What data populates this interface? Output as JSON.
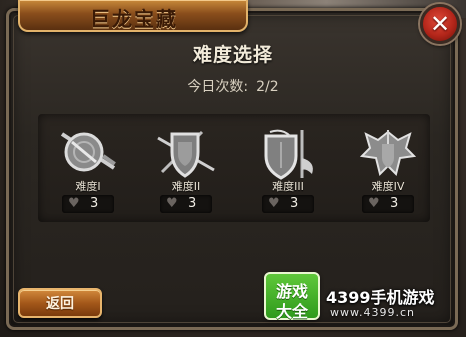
{
  "dialog": {
    "title": "巨龙宝藏",
    "heading": "难度选择",
    "count_label": "今日次数:",
    "count_value": "2/2",
    "close_icon": "✕"
  },
  "difficulties": [
    {
      "label": "难度I",
      "icon": "round-shield-sword-icon",
      "hearts": "3"
    },
    {
      "label": "难度II",
      "icon": "kite-shield-swords-icon",
      "hearts": "3"
    },
    {
      "label": "难度III",
      "icon": "shield-axe-icon",
      "hearts": "3"
    },
    {
      "label": "难度IV",
      "icon": "armor-wings-icon",
      "hearts": "3"
    }
  ],
  "back_label": "返回",
  "watermark": {
    "logo_line1": "游戏",
    "logo_line2": "大全",
    "title": "4399手机游戏",
    "url": "www.4399.cn"
  },
  "colors": {
    "accent_gold": "#c98a3a",
    "close_red": "#b3261a",
    "watermark_green": "#2f9a1c"
  }
}
